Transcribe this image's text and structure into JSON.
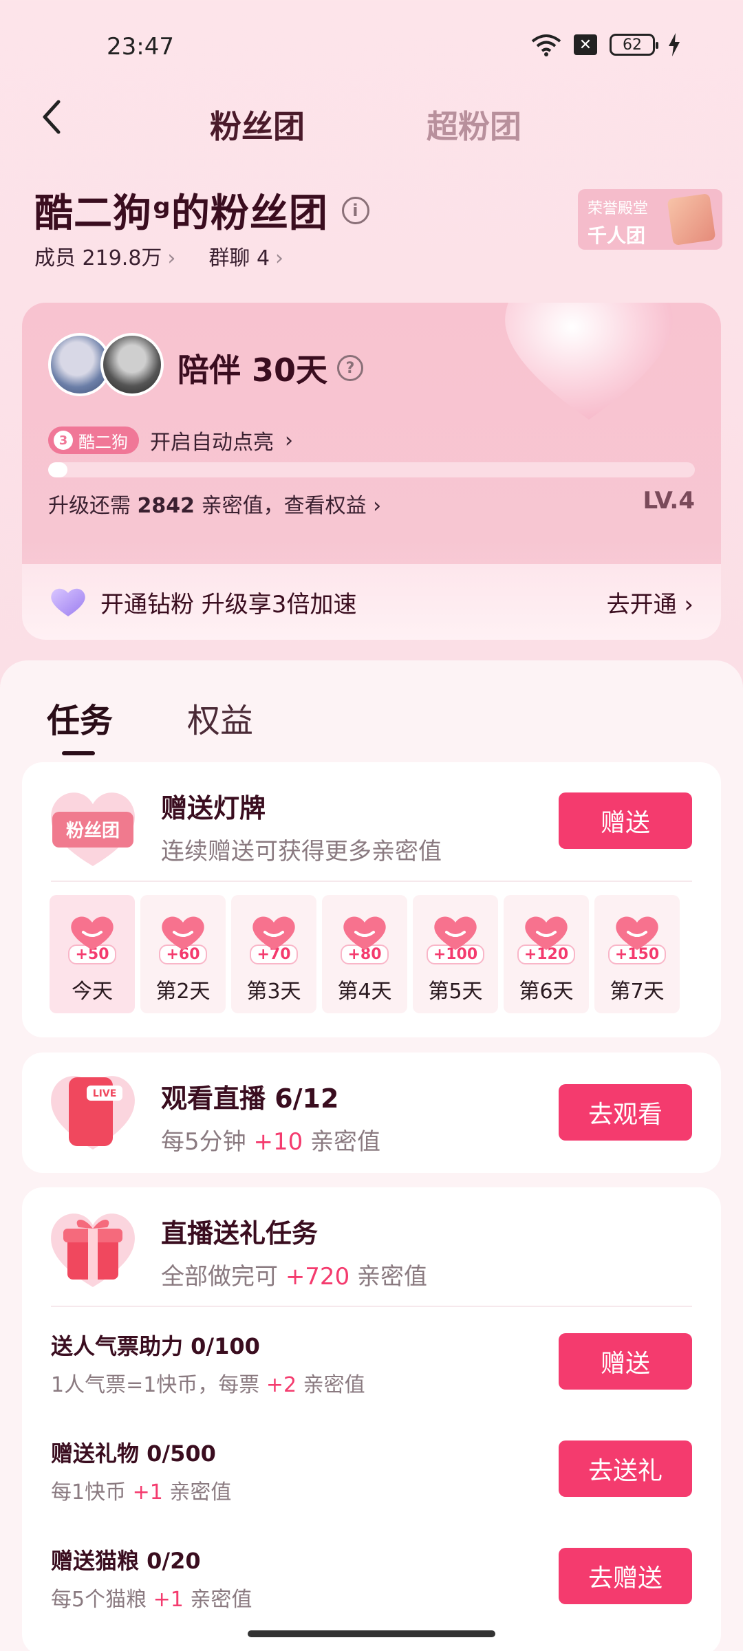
{
  "status": {
    "time": "23:47",
    "battery": "62"
  },
  "header": {
    "tab_active": "粉丝团",
    "tab_inactive": "超粉团"
  },
  "group": {
    "title": "酷二狗ᵍ的粉丝团",
    "members": "成员 219.8万",
    "chat": "群聊 4",
    "honor_line1": "荣誉殿堂",
    "honor_line2": "千人团"
  },
  "companion": {
    "label": "陪伴",
    "days": "30",
    "days_unit": "天",
    "lamp_level": "3",
    "lamp_name": "酷二狗",
    "auto_light": "开启自动点亮",
    "upgrade_prefix": "升级还需 ",
    "upgrade_value": "2842",
    "upgrade_suffix": " 亲密值，查看权益",
    "level": "LV.4",
    "progress": 0.03
  },
  "diamond": {
    "text": "开通钻粉 升级享3倍加速",
    "link": "去开通"
  },
  "tabs": {
    "task": "任务",
    "rights": "权益"
  },
  "task_lamp": {
    "badge_text": "粉丝团",
    "title": "赠送灯牌",
    "desc": "连续赠送可获得更多亲密值",
    "button": "赠送",
    "days": [
      {
        "value": "+50",
        "label": "今天"
      },
      {
        "value": "+60",
        "label": "第2天"
      },
      {
        "value": "+70",
        "label": "第3天"
      },
      {
        "value": "+80",
        "label": "第4天"
      },
      {
        "value": "+100",
        "label": "第5天"
      },
      {
        "value": "+120",
        "label": "第6天"
      },
      {
        "value": "+150",
        "label": "第7天"
      }
    ]
  },
  "task_watch": {
    "live_badge": "LIVE",
    "title": "观看直播 6/12",
    "desc_prefix": "每5分钟 ",
    "desc_value": "+10",
    "desc_suffix": " 亲密值",
    "button": "去观看"
  },
  "task_gift": {
    "title": "直播送礼任务",
    "desc_prefix": "全部做完可 ",
    "desc_value": "+720",
    "desc_suffix": " 亲密值",
    "items": [
      {
        "title": "送人气票助力 0/100",
        "desc_prefix": "1人气票=1快币，每票 ",
        "desc_value": "+2",
        "desc_suffix": " 亲密值",
        "button": "赠送"
      },
      {
        "title": "赠送礼物 0/500",
        "desc_prefix": "每1快币 ",
        "desc_value": "+1",
        "desc_suffix": " 亲密值",
        "button": "去送礼"
      },
      {
        "title": "赠送猫粮 0/20",
        "desc_prefix": "每5个猫粮 ",
        "desc_value": "+1",
        "desc_suffix": " 亲密值",
        "button": "去赠送"
      }
    ]
  }
}
